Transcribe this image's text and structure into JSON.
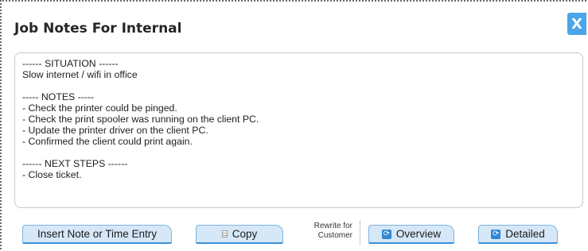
{
  "dialog": {
    "title": "Job Notes For Internal",
    "close_label": "X"
  },
  "notes": {
    "lines": [
      "------ SITUATION ------",
      "Slow internet / wifi in office",
      "",
      "----- NOTES -----",
      "- Check the printer could be pinged.",
      "- Check the print spooler was running on the client PC.",
      "- Update the printer driver on the client PC.",
      "- Confirmed the client could print again.",
      "",
      "------ NEXT STEPS ------",
      "- Close ticket."
    ]
  },
  "toolbar": {
    "insert_label": "Insert Note or Time Entry",
    "copy_label": "Copy",
    "rewrite_line1": "Rewrite for",
    "rewrite_line2": "Customer",
    "overview_label": "Overview",
    "detailed_label": "Detailed"
  },
  "icons": {
    "copy": "document-icon",
    "overview": "refresh-icon",
    "detailed": "refresh-icon"
  },
  "colors": {
    "accent": "#4aa6e9",
    "button_bg": "#d6e8f8",
    "button_border": "#3d8fd4"
  }
}
